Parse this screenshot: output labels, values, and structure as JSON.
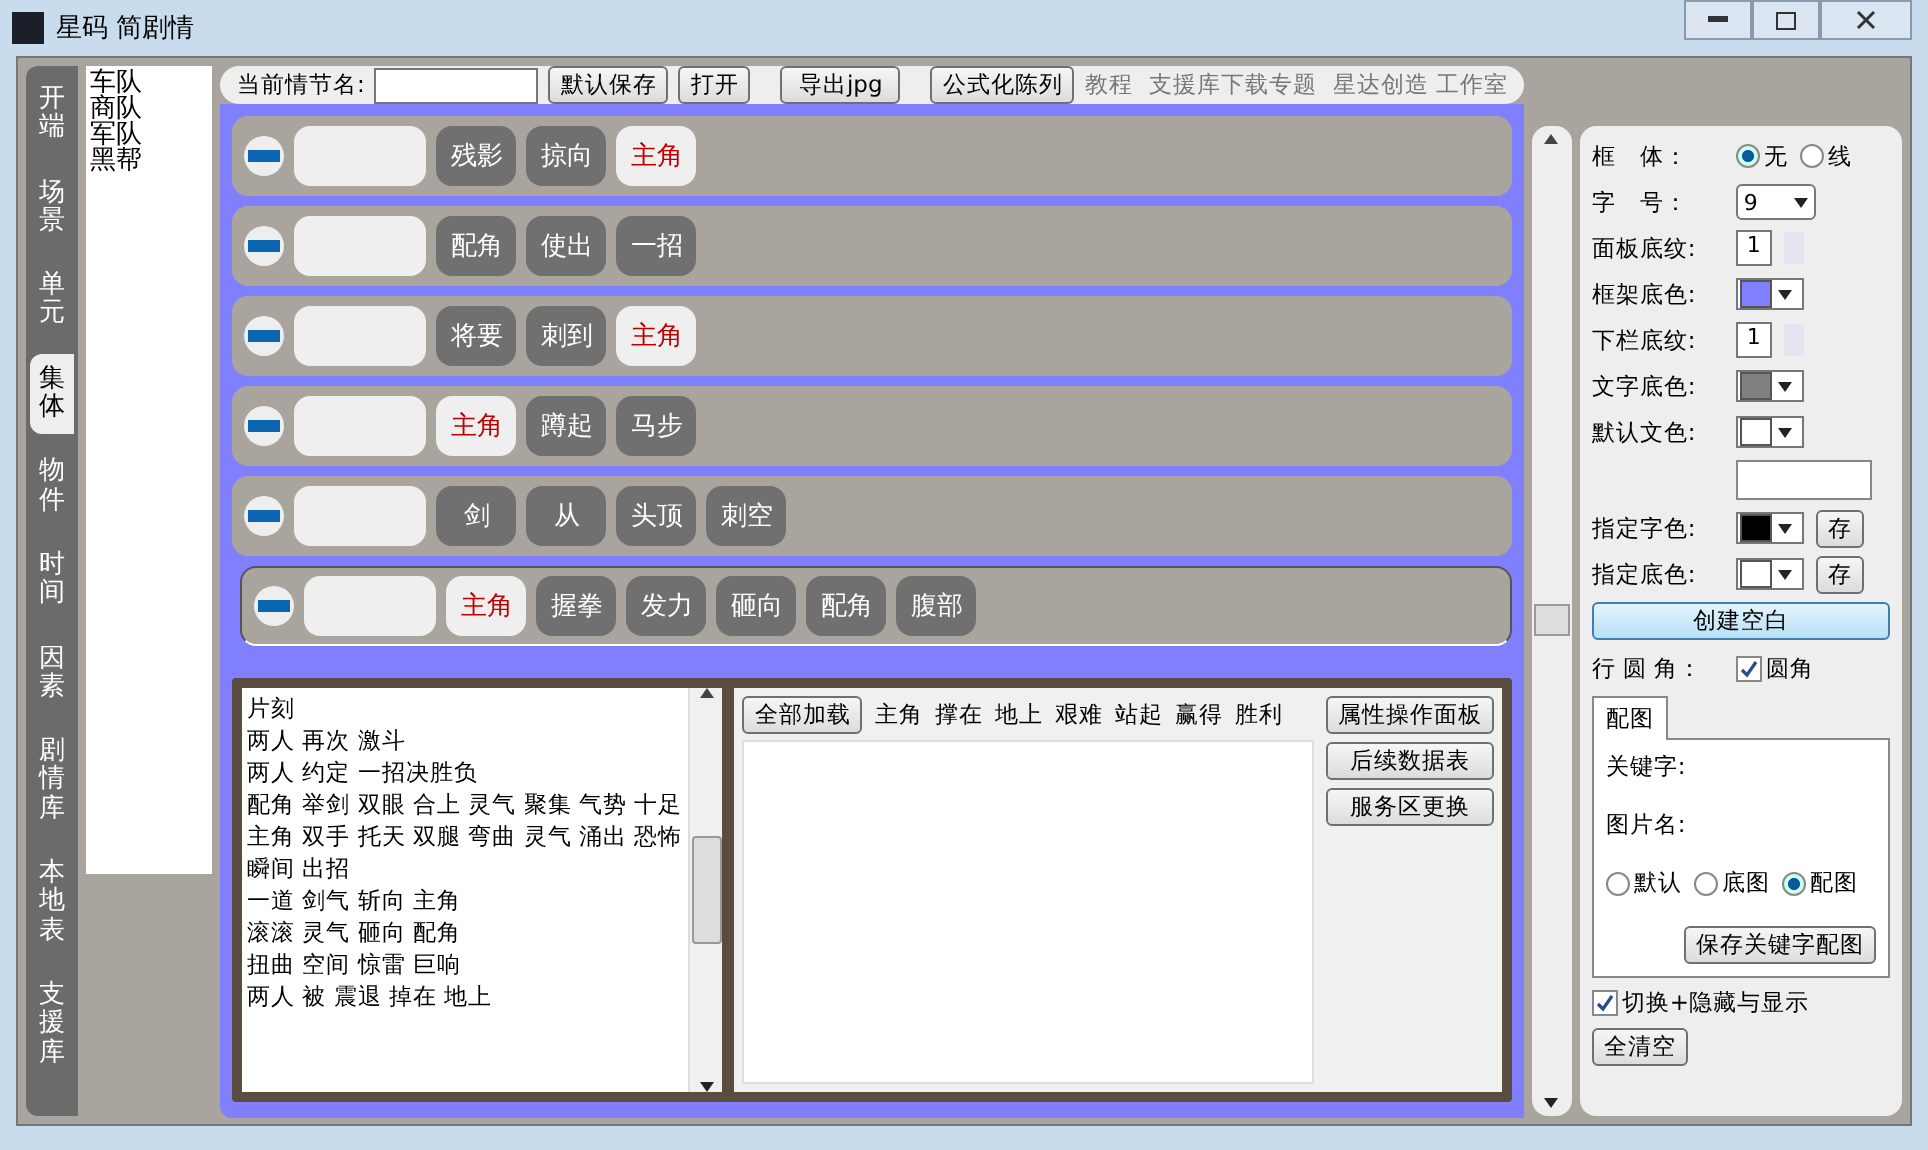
{
  "window": {
    "title": "星码 简剧情"
  },
  "side_tabs": [
    {
      "label": "开端",
      "selected": false
    },
    {
      "label": "场景",
      "selected": false
    },
    {
      "label": "单元",
      "selected": false
    },
    {
      "label": "集体",
      "selected": true
    },
    {
      "label": "物件",
      "selected": false
    },
    {
      "label": "时间",
      "selected": false
    },
    {
      "label": "因素",
      "selected": false
    },
    {
      "label": "剧情库",
      "selected": false
    },
    {
      "label": "本地表",
      "selected": false
    },
    {
      "label": "支援库",
      "selected": false
    }
  ],
  "category_list": [
    "车队",
    "商队",
    "军队",
    "黑帮"
  ],
  "toolbar": {
    "name_label": "当前情节名:",
    "buttons": [
      "默认保存",
      "打开",
      "导出jpg",
      "公式化陈列"
    ],
    "links": [
      "教程",
      "支援库下载专题",
      "星达创造 工作室"
    ]
  },
  "rows": [
    {
      "selected": false,
      "chips": [
        {
          "text": "残影",
          "kind": "word"
        },
        {
          "text": "掠向",
          "kind": "word"
        },
        {
          "text": "主角",
          "kind": "role"
        }
      ]
    },
    {
      "selected": false,
      "chips": [
        {
          "text": "配角",
          "kind": "word"
        },
        {
          "text": "使出",
          "kind": "word"
        },
        {
          "text": "一招",
          "kind": "word"
        }
      ]
    },
    {
      "selected": false,
      "chips": [
        {
          "text": "将要",
          "kind": "word"
        },
        {
          "text": "刺到",
          "kind": "word"
        },
        {
          "text": "主角",
          "kind": "role"
        }
      ]
    },
    {
      "selected": false,
      "chips": [
        {
          "text": "主角",
          "kind": "role"
        },
        {
          "text": "蹲起",
          "kind": "word"
        },
        {
          "text": "马步",
          "kind": "word"
        }
      ]
    },
    {
      "selected": false,
      "chips": [
        {
          "text": "剑",
          "kind": "word"
        },
        {
          "text": "从",
          "kind": "word"
        },
        {
          "text": "头顶",
          "kind": "word"
        },
        {
          "text": "刺空",
          "kind": "word"
        }
      ]
    },
    {
      "selected": true,
      "chips": [
        {
          "text": "主角",
          "kind": "role"
        },
        {
          "text": "握拳",
          "kind": "word"
        },
        {
          "text": "发力",
          "kind": "word"
        },
        {
          "text": "砸向",
          "kind": "word"
        },
        {
          "text": "配角",
          "kind": "word"
        },
        {
          "text": "腹部",
          "kind": "word"
        }
      ]
    }
  ],
  "script_lines": [
    "片刻",
    "两人 再次 激斗",
    "两人 约定 一招决胜负",
    "配角 举剑 双眼 合上 灵气 聚集 气势 十足",
    "主角 双手 托天 双腿 弯曲 灵气 涌出 恐怖",
    "瞬间 出招",
    "一道 剑气 斩向 主角",
    "滚滚 灵气 砸向 配角",
    "扭曲 空间 惊雷 巨响",
    "两人 被 震退 掉在 地上"
  ],
  "loader": {
    "button": "全部加载",
    "words": [
      "主角",
      "撑在",
      "地上",
      "艰难",
      "站起",
      "赢得",
      "胜利"
    ]
  },
  "side_buttons": [
    "属性操作面板",
    "后续数据表",
    "服务区更换"
  ],
  "settings": {
    "frame": {
      "label": "框　体：",
      "options": [
        {
          "label": "无",
          "selected": true
        },
        {
          "label": "线",
          "selected": false
        }
      ]
    },
    "font_size": {
      "label": "字　号：",
      "value": "9"
    },
    "panel_texture": {
      "label": "面板底纹:",
      "value": "1"
    },
    "frame_color": {
      "label": "框架底色:",
      "color": "#8080ff"
    },
    "bar_texture": {
      "label": "下栏底纹:",
      "value": "1"
    },
    "text_bg": {
      "label": "文字底色:",
      "color": "#808080"
    },
    "default_text_color": {
      "label": "默认文色:",
      "color": "#ffffff"
    },
    "text_color": {
      "label": "指定字色:",
      "color": "#000000",
      "button": "存"
    },
    "bg_color": {
      "label": "指定底色:",
      "color": "#ffffff",
      "button": "存"
    },
    "create_button": "创建空白",
    "round": {
      "label": "行 圆 角：",
      "checkbox": "圆角",
      "checked": true
    }
  },
  "image_tab": {
    "tab": "配图",
    "keyword_label": "关键字:",
    "image_label": "图片名:",
    "options": [
      {
        "label": "默认",
        "selected": false
      },
      {
        "label": "底图",
        "selected": false
      },
      {
        "label": "配图",
        "selected": true
      }
    ],
    "save_button": "保存关键字配图"
  },
  "toggle": {
    "label": "切换+隐藏与显示",
    "checked": true
  },
  "clear_button": "全清空"
}
